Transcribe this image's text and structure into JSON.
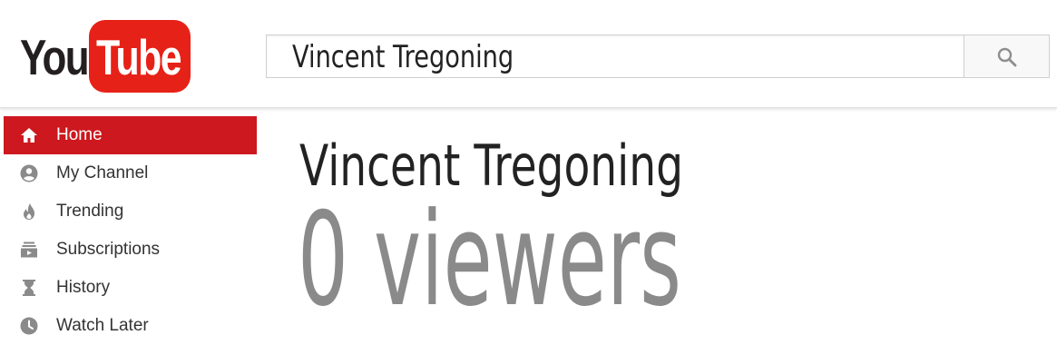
{
  "logo": {
    "you": "You",
    "tube": "Tube"
  },
  "search": {
    "value": "Vincent Tregoning"
  },
  "sidebar": {
    "items": [
      {
        "label": "Home",
        "icon": "home-icon",
        "active": true
      },
      {
        "label": "My Channel",
        "icon": "account-icon",
        "active": false
      },
      {
        "label": "Trending",
        "icon": "flame-icon",
        "active": false
      },
      {
        "label": "Subscriptions",
        "icon": "subscriptions-icon",
        "active": false
      },
      {
        "label": "History",
        "icon": "hourglass-icon",
        "active": false
      },
      {
        "label": "Watch Later",
        "icon": "clock-icon",
        "active": false
      }
    ]
  },
  "main": {
    "title": "Vincent Tregoning",
    "viewers": "0 viewers"
  },
  "colors": {
    "brand_red": "#e62117",
    "active_red": "#cc181e",
    "viewers_gray": "#8a8a8a"
  }
}
